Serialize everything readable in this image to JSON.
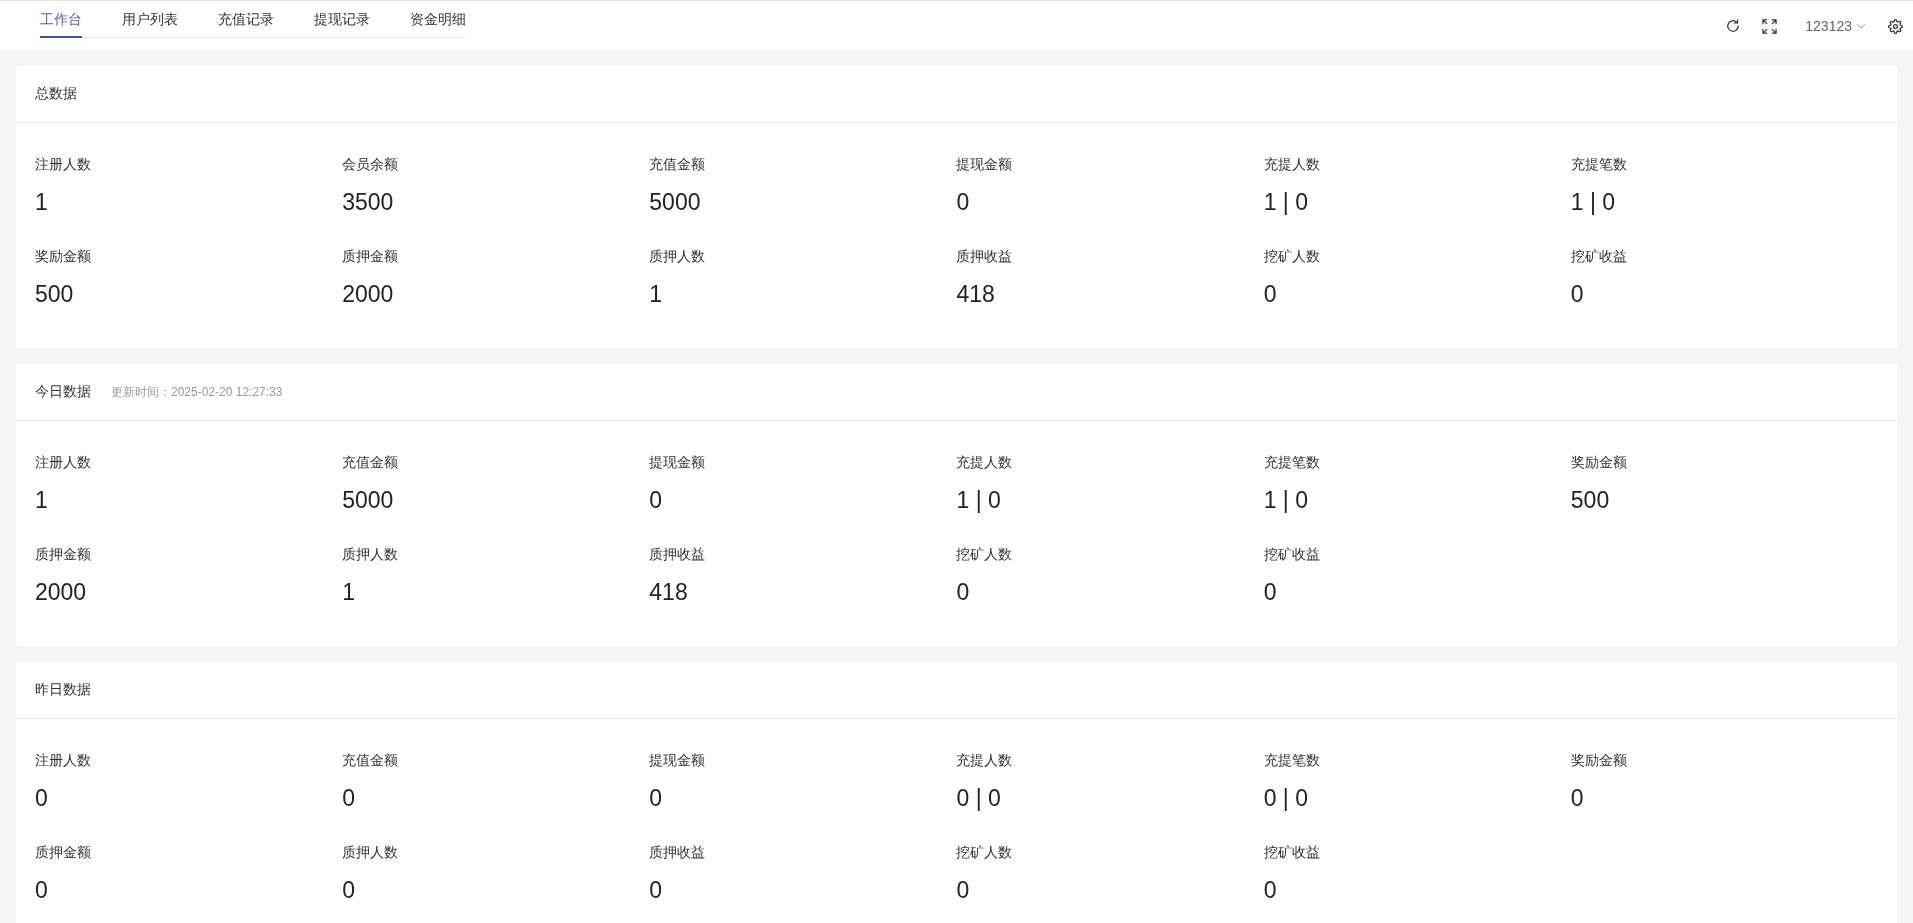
{
  "tabs": [
    {
      "label": "工作台",
      "selected": true
    },
    {
      "label": "用户列表",
      "selected": false
    },
    {
      "label": "充值记录",
      "selected": false
    },
    {
      "label": "提现记录",
      "selected": false
    },
    {
      "label": "资金明细",
      "selected": false
    }
  ],
  "user_menu": {
    "label": "123123"
  },
  "panels": [
    {
      "title": "总数据",
      "stats": [
        {
          "label": "注册人数",
          "value": "1"
        },
        {
          "label": "会员余额",
          "value": "3500"
        },
        {
          "label": "充值金额",
          "value": "5000"
        },
        {
          "label": "提现金额",
          "value": "0"
        },
        {
          "label": "充提人数",
          "value": "1 | 0"
        },
        {
          "label": "充提笔数",
          "value": "1 | 0"
        },
        {
          "label": "奖励金额",
          "value": "500"
        },
        {
          "label": "质押金额",
          "value": "2000"
        },
        {
          "label": "质押人数",
          "value": "1"
        },
        {
          "label": "质押收益",
          "value": "418"
        },
        {
          "label": "挖矿人数",
          "value": "0"
        },
        {
          "label": "挖矿收益",
          "value": "0"
        }
      ]
    },
    {
      "title": "今日数据",
      "updated": "更新时间：2025-02-20 12:27:33",
      "stats": [
        {
          "label": "注册人数",
          "value": "1"
        },
        {
          "label": "充值金额",
          "value": "5000"
        },
        {
          "label": "提现金额",
          "value": "0"
        },
        {
          "label": "充提人数",
          "value": "1 | 0"
        },
        {
          "label": "充提笔数",
          "value": "1 | 0"
        },
        {
          "label": "奖励金额",
          "value": "500"
        },
        {
          "label": "质押金额",
          "value": "2000"
        },
        {
          "label": "质押人数",
          "value": "1"
        },
        {
          "label": "质押收益",
          "value": "418"
        },
        {
          "label": "挖矿人数",
          "value": "0"
        },
        {
          "label": "挖矿收益",
          "value": "0"
        }
      ]
    },
    {
      "title": "昨日数据",
      "stats": [
        {
          "label": "注册人数",
          "value": "0"
        },
        {
          "label": "充值金额",
          "value": "0"
        },
        {
          "label": "提现金额",
          "value": "0"
        },
        {
          "label": "充提人数",
          "value": "0 | 0"
        },
        {
          "label": "充提笔数",
          "value": "0 | 0"
        },
        {
          "label": "奖励金额",
          "value": "0"
        },
        {
          "label": "质押金额",
          "value": "0"
        },
        {
          "label": "质押人数",
          "value": "0"
        },
        {
          "label": "质押收益",
          "value": "0"
        },
        {
          "label": "挖矿人数",
          "value": "0"
        },
        {
          "label": "挖矿收益",
          "value": "0"
        }
      ]
    }
  ]
}
